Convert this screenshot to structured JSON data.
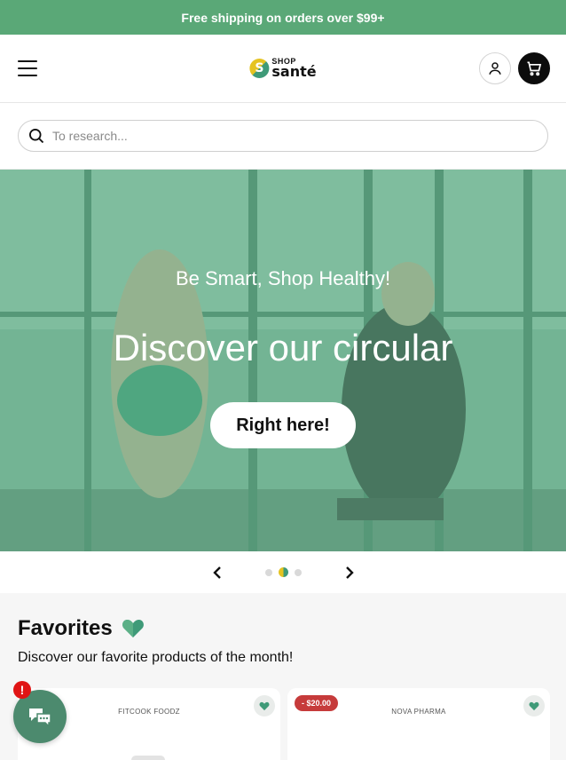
{
  "announcement": {
    "text": "Free shipping on orders over $99+"
  },
  "header": {
    "logo_shop": "SHOP",
    "logo_sante": "santé"
  },
  "search": {
    "placeholder": "To research..."
  },
  "hero": {
    "kicker": "Be Smart, Shop Healthy!",
    "title": "Discover our circular",
    "button": "Right here!",
    "overlay_color": "#5cb087"
  },
  "carousel": {
    "slide_count": 3,
    "active_index": 1
  },
  "favorites": {
    "title": "Favorites",
    "subtitle": "Discover our favorite products of the month!",
    "products": [
      {
        "brand": "FITCOOK FOODZ",
        "discount": ""
      },
      {
        "brand": "NOVA PHARMA",
        "discount": "- $20.00"
      }
    ]
  },
  "chat": {
    "badge": "!"
  },
  "colors": {
    "brand_green": "#5aa877",
    "accent_yellow": "#e5c321",
    "sale_red": "#c63b3b"
  }
}
